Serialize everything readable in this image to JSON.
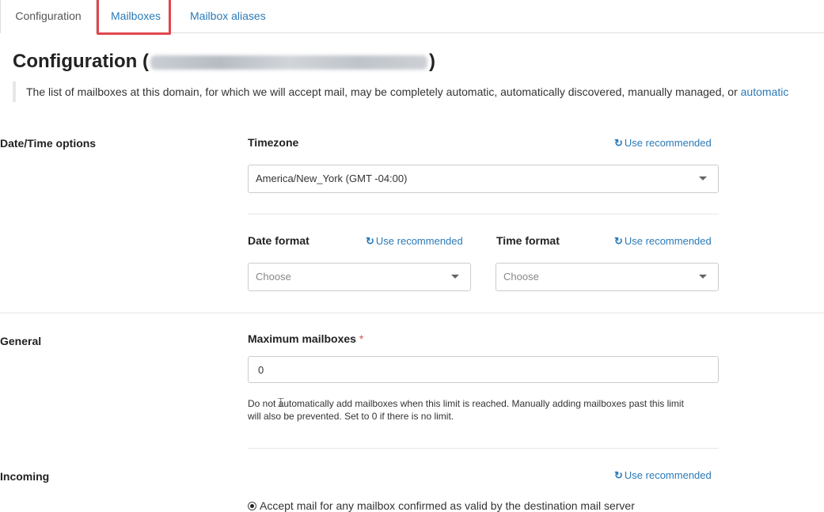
{
  "tabs": [
    {
      "label": "Configuration"
    },
    {
      "label": "Mailboxes"
    },
    {
      "label": "Mailbox aliases"
    }
  ],
  "page": {
    "title_prefix": "Configuration (",
    "title_suffix": ")",
    "lead_text": "The list of mailboxes at this domain, for which we will accept mail, may be completely automatic, automatically discovered, manually managed, or ",
    "lead_link": "automatic"
  },
  "recommend_label": "Use recommended",
  "datetime": {
    "section_label": "Date/Time options",
    "timezone_label": "Timezone",
    "timezone_value": "America/New_York (GMT -04:00)",
    "date_format_label": "Date format",
    "date_format_value": "Choose",
    "time_format_label": "Time format",
    "time_format_value": "Choose"
  },
  "general": {
    "section_label": "General",
    "max_label": "Maximum mailboxes",
    "required_mark": "*",
    "max_value": "0",
    "help_line1": "Do not automatically add mailboxes when this limit is reached. Manually adding mailboxes past this limit",
    "help_line2": "will also be prevented. Set to 0 if there is no limit."
  },
  "incoming": {
    "section_label": "Incoming",
    "radio_label": "Accept mail for any mailbox confirmed as valid by the destination mail server"
  },
  "icons": {
    "refresh": "refresh-icon",
    "caret": "chevron-down-icon",
    "text_cursor": "text-cursor-icon"
  }
}
